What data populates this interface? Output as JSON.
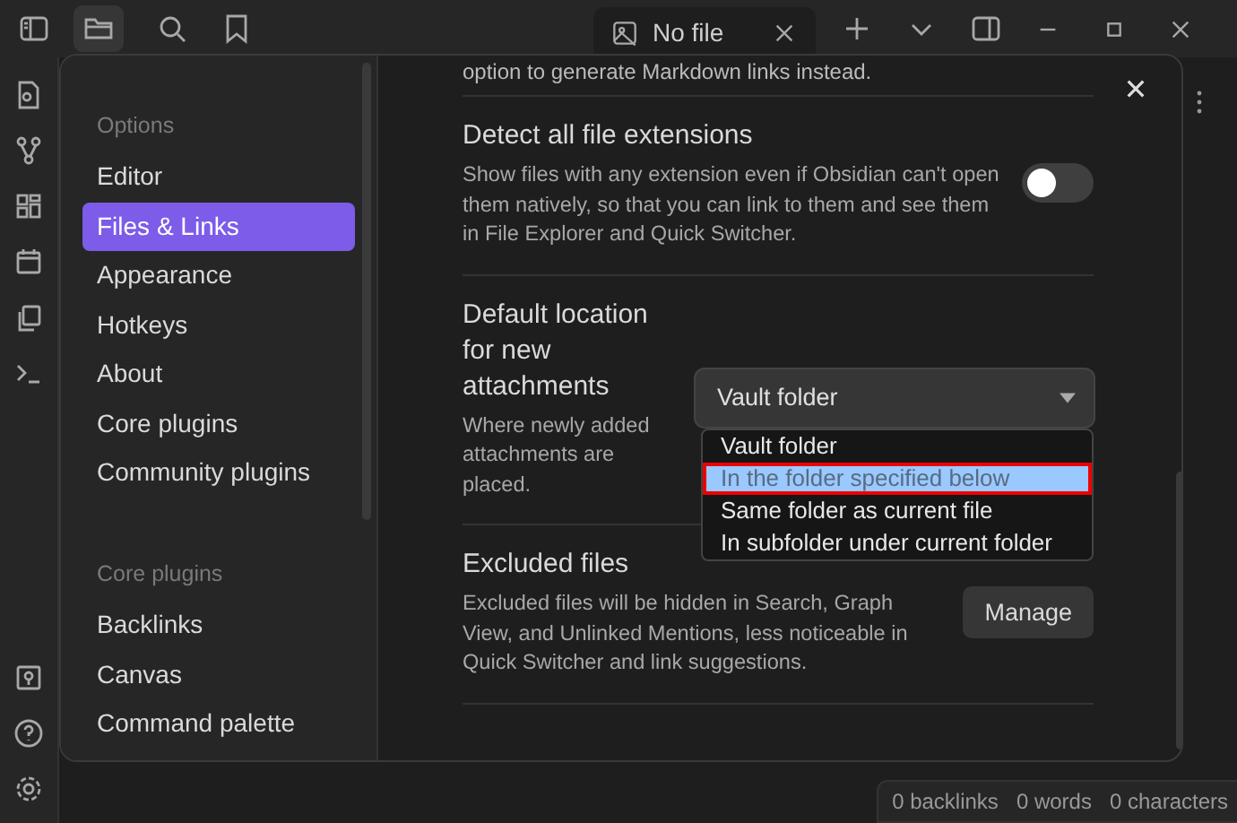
{
  "tab": {
    "title": "No file"
  },
  "settings_sidebar": [
    {
      "heading": "Options",
      "items": [
        {
          "label": "Editor",
          "selected": false
        },
        {
          "label": "Files & Links",
          "selected": true
        },
        {
          "label": "Appearance",
          "selected": false
        },
        {
          "label": "Hotkeys",
          "selected": false
        },
        {
          "label": "About",
          "selected": false
        },
        {
          "label": "Core plugins",
          "selected": false
        },
        {
          "label": "Community plugins",
          "selected": false
        }
      ]
    },
    {
      "heading": "Core plugins",
      "items": [
        {
          "label": "Backlinks",
          "selected": false
        },
        {
          "label": "Canvas",
          "selected": false
        },
        {
          "label": "Command palette",
          "selected": false
        }
      ]
    }
  ],
  "previous_description": "option to generate Markdown links instead.",
  "settings": [
    {
      "kind": "toggle",
      "name": "Detect all file extensions",
      "description": "Show files with any extension even if Obsidian can't open them natively, so that you can link to them and see them in File Explorer and Quick Switcher.",
      "on": false
    },
    {
      "kind": "dropdown",
      "name": "Default location for new attachments",
      "description": "Where newly added attachments are placed.",
      "value": "Vault folder",
      "expanded": true,
      "options": [
        {
          "label": "Vault folder",
          "highlighted": false
        },
        {
          "label": "In the folder specified below",
          "highlighted": true
        },
        {
          "label": "Same folder as current file",
          "highlighted": false
        },
        {
          "label": "In subfolder under current folder",
          "highlighted": false
        }
      ]
    },
    {
      "kind": "button",
      "name": "Excluded files",
      "description": "Excluded files will be hidden in Search, Graph View, and Unlinked Mentions, less noticeable in Quick Switcher and link suggestions.",
      "button": "Manage"
    }
  ],
  "status_bar": [
    "0 backlinks",
    "0 words",
    "0 characters"
  ]
}
